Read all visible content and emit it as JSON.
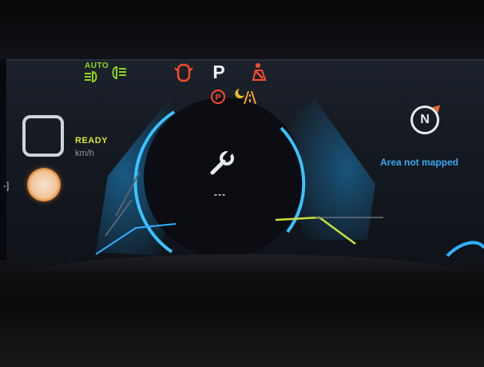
{
  "telltales": {
    "auto_label": "AUTO",
    "auto_headlight_icon": "auto-headlight-icon",
    "low_beam_icon": "low-beam-icon",
    "door_open_icon": "door-open-icon",
    "gear": "P",
    "seatbelt_icon": "seatbelt-icon",
    "parking_brake_icon": "parking-brake-icon",
    "night_mode_icon": "night-mode-icon",
    "lane_icon": "lane-departure-icon",
    "colors": {
      "green": "#8fd61e",
      "red": "#ff4a2a",
      "orange": "#f3a020"
    }
  },
  "speed": {
    "status": "READY",
    "unit": "km/h",
    "charge_bracket": "-]"
  },
  "center": {
    "service_icon": "wrench-icon",
    "value": "---"
  },
  "navigation": {
    "compass_label": "N",
    "message": "Area not mapped",
    "color": "#37a9f2"
  }
}
